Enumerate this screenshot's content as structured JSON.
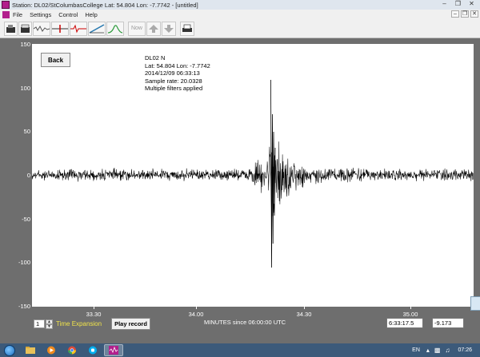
{
  "window": {
    "title": "Station: DL02/StColumbasCollege Lat: 54.804 Lon: -7.7742 - [untitled]",
    "controls": [
      "minimize",
      "restore",
      "close"
    ]
  },
  "menu": {
    "items": [
      "File",
      "Settings",
      "Control",
      "Help"
    ]
  },
  "toolbar": {
    "now_label": "Now",
    "buttons": [
      "open-icon",
      "save-icon",
      "trace-icon",
      "filter-icon",
      "trace-red-icon",
      "autoscale-icon",
      "spectrum-icon",
      "up-arrow-icon",
      "down-arrow-icon",
      "print-icon"
    ]
  },
  "plot": {
    "back_label": "Back",
    "info": {
      "station": "DL02  N",
      "coords": "Lat: 54.804 Lon: -7.7742",
      "datetime": "2014/12/09 06:33:13",
      "sample_rate": "Sample rate: 20.0328",
      "filters": "Multiple filters applied"
    },
    "y_ticks": [
      "150",
      "100",
      "50",
      "0",
      "-50",
      "-100",
      "-150"
    ],
    "x_ticks": [
      "33.30",
      "34.00",
      "34.30",
      "35.00"
    ],
    "x_axis_title": "MINUTES since 06:00:00 UTC",
    "trace_color": "#000000"
  },
  "bottom": {
    "time_expansion_value": "1",
    "time_expansion_label": "Time Expansion",
    "play_label": "Play record",
    "cursor_time": "6:33:17.5",
    "cursor_value": "-9.173",
    "time_expansion_color": "#f0e34a"
  },
  "taskbar": {
    "language": "EN",
    "clock": "07:26",
    "apps": [
      "windows-explorer-icon",
      "media-player-icon",
      "chrome-icon",
      "skype-icon",
      "seismograph-app-icon"
    ]
  }
}
